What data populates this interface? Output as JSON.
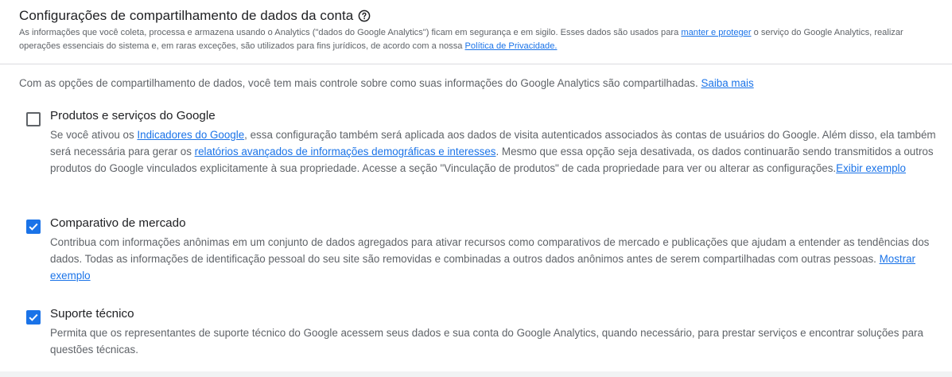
{
  "header": {
    "title": "Configurações de compartilhamento de dados da conta",
    "help_icon": "help-circle-icon",
    "desc_part1": "As informações que você coleta, processa e armazena usando o Analytics (\"dados do Google Analytics\") ficam em segurança e em sigilo. Esses dados são usados para ",
    "link_manter": "manter e proteger",
    "desc_part2": " o serviço do Google Analytics, realizar operações essenciais do sistema e, em raras exceções, são utilizados para fins jurídicos, de acordo com a nossa ",
    "link_privacidade": "Política de Privacidade."
  },
  "intro": {
    "text": "Com as opções de compartilhamento de dados, você tem mais controle sobre como suas informações do Google Analytics são compartilhadas. ",
    "link": "Saiba mais"
  },
  "options": [
    {
      "title": "Produtos e serviços do Google",
      "checked": false,
      "desc_part1": "Se você ativou os ",
      "link1": "Indicadores do Google",
      "desc_part2": ", essa configuração também será aplicada aos dados de visita autenticados associados às contas de usuários do Google. Além disso, ela também será necessária para gerar os ",
      "link2": "relatórios avançados de informações demográficas e interesses",
      "desc_part3": ". Mesmo que essa opção seja desativada, os dados continuarão sendo transmitidos a outros produtos do Google vinculados explicitamente à sua propriedade. Acesse a seção \"Vinculação de produtos\" de cada propriedade para ver ou alterar as configurações.",
      "link3": "Exibir exemplo"
    },
    {
      "title": "Comparativo de mercado",
      "checked": true,
      "desc": "Contribua com informações anônimas em um conjunto de dados agregados para ativar recursos como comparativos de mercado e publicações que ajudam a entender as tendências dos dados. Todas as informações de identificação pessoal do seu site são removidas e combinadas a outros dados anônimos antes de serem compartilhadas com outras pessoas. ",
      "link": "Mostrar exemplo"
    },
    {
      "title": "Suporte técnico",
      "checked": true,
      "desc": "Permita que os representantes de suporte técnico do Google acessem seus dados e sua conta do Google Analytics, quando necessário, para prestar serviços e encontrar soluções para questões técnicas."
    }
  ],
  "colors": {
    "accent": "#1a73e8",
    "text_primary": "#202124",
    "text_secondary": "#5f6368",
    "divider": "#dadce0"
  }
}
